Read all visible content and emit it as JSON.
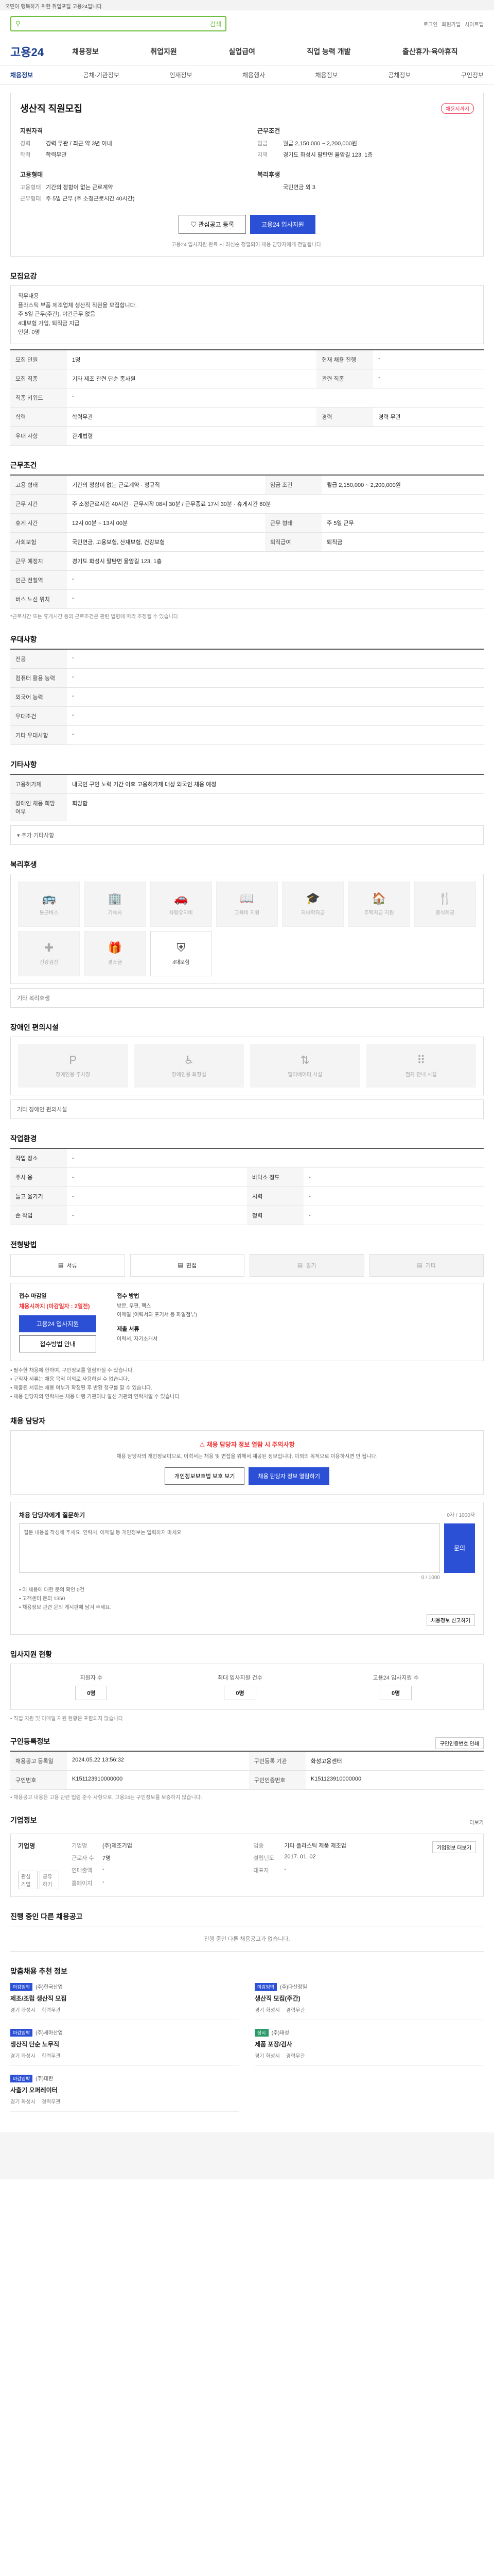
{
  "topbar": {
    "text": "국민이 행복하기 위한 취업포탈 고용24입니다."
  },
  "search": {
    "value": "",
    "button": "검색"
  },
  "user_links": [
    "로그인",
    "회원가입",
    "사이트맵"
  ],
  "logo": "고용24",
  "gnb": [
    "채용정보",
    "취업지원",
    "실업급여",
    "직업 능력 개발",
    "출산휴가·육아휴직"
  ],
  "subnav": [
    "채용정보",
    "공채·기관정보",
    "인재정보",
    "채용행사",
    "채용정보",
    "공채정보",
    "구인정보"
  ],
  "title": {
    "heading": "생산직 직원모집",
    "badge": "채용시까지",
    "left_title": "지원자격",
    "left_rows": [
      {
        "k": "경력",
        "v": "경력 무관 / 최근 약 3년 이내"
      },
      {
        "k": "학력",
        "v": "학력무관"
      }
    ],
    "right_title": "근무조건",
    "right_rows": [
      {
        "k": "임금",
        "v": "월급 2,150,000 ~ 2,200,000원"
      },
      {
        "k": "지역",
        "v": "경기도 화성시 팔탄면 율암길 123, 1층"
      }
    ],
    "left2_title": "고용형태",
    "left2_rows": [
      {
        "k": "고용형태",
        "v": "기간의 정함이 없는 근로계약"
      },
      {
        "k": "근무형태",
        "v": "주 5일 근무 (주 소정근로시간 40시간)"
      }
    ],
    "right2_title": "복리후생",
    "right2_rows": [
      {
        "k": "",
        "v": "국민연금 외 3"
      }
    ],
    "btn_interest": "관심공고 등록",
    "btn_apply": "고용24 입사지원",
    "note": "고용24 입사지원 완료 시 최신순 정렬되어 채용 담당자에게 전달됩니다."
  },
  "recruit": {
    "heading": "모집요강",
    "notice_lines": [
      "직무내용",
      "플라스틱 부품 제조업체 생산직 직원을 모집합니다.",
      "주 5일 근무(주간), 야간근무 없음",
      "4대보험 가입, 퇴직금 지급",
      "인원: 0명"
    ],
    "rows": [
      {
        "k": "모집 인원",
        "v": "1명",
        "k2": "현재 채용 진행",
        "v2": "-"
      },
      {
        "k": "모집 직종",
        "v": "기타 제조 관련 단순 종사원",
        "k2": "관련 직종",
        "v2": "-"
      },
      {
        "k": "직종 키워드",
        "v": "-",
        "k2": "",
        "v2": ""
      },
      {
        "k": "학력",
        "v": "학력무관",
        "k2": "경력",
        "v2": "경력 무관"
      },
      {
        "k": "우대 사항",
        "v": "관계법령",
        "k2": "",
        "v2": ""
      }
    ]
  },
  "conditions": {
    "heading": "근무조건",
    "rows": [
      {
        "k": "고용 형태",
        "v": "기간의 정함이 없는 근로계약 · 정규직",
        "k2": "임금 조건",
        "v2": "월급 2,150,000 ~ 2,200,000원"
      },
      {
        "k": "근무 시간",
        "v": "주 소정근로시간 40시간 · 근무시작 08시 30분 / 근무종료 17시 30분 · 휴게시간 60분",
        "k2": "",
        "v2": ""
      },
      {
        "k": "휴게 시간",
        "v": "12시 00분 ~ 13시 00분",
        "k2": "근무 형태",
        "v2": "주 5일 근무"
      },
      {
        "k": "사회보험",
        "v": "국민연금, 고용보험, 산재보험, 건강보험",
        "k2": "퇴직급여",
        "v2": "퇴직금"
      },
      {
        "k": "근무 예정지",
        "v": "경기도 화성시 팔탄면 율암길 123, 1층",
        "k2": "",
        "v2": ""
      },
      {
        "k": "인근 전철역",
        "v": "-",
        "k2": "",
        "v2": ""
      },
      {
        "k": "버스 노선 위치",
        "v": "-",
        "k2": "",
        "v2": ""
      }
    ],
    "footnote": "*근로시간 또는 휴게시간 등의 근로조건은 관련 법령에 따라 조정될 수 있습니다."
  },
  "preference": {
    "heading": "우대사항",
    "rows": [
      {
        "k": "전공",
        "v": "-"
      },
      {
        "k": "컴퓨터 활용 능력",
        "v": "-"
      },
      {
        "k": "외국어 능력",
        "v": "-"
      },
      {
        "k": "우대조건",
        "v": "-"
      },
      {
        "k": "기타 우대사항",
        "v": "-"
      }
    ]
  },
  "etc": {
    "heading": "기타사항",
    "rows": [
      {
        "k": "고용허가제",
        "v": "내국인 구인 노력 기간 이후 고용허가제 대상 외국인 채용 예정"
      },
      {
        "k": "장애인 채용 희망 여부",
        "v": "희망함"
      }
    ],
    "more": "추가 기타사항"
  },
  "welfare": {
    "heading": "복리후생",
    "items": [
      {
        "label": "통근버스",
        "icon": "bus-icon",
        "active": false
      },
      {
        "label": "기숙사",
        "icon": "building-icon",
        "active": false
      },
      {
        "label": "차량유지비",
        "icon": "car-icon",
        "active": false
      },
      {
        "label": "교육비 지원",
        "icon": "book-icon",
        "active": false
      },
      {
        "label": "자녀학자금",
        "icon": "school-icon",
        "active": false
      },
      {
        "label": "주택자금 지원",
        "icon": "house-icon",
        "active": false
      },
      {
        "label": "중식제공",
        "icon": "meal-icon",
        "active": false
      },
      {
        "label": "건강검진",
        "icon": "health-icon",
        "active": false
      },
      {
        "label": "경조금",
        "icon": "gift-icon",
        "active": false
      },
      {
        "label": "4대보험",
        "icon": "shield-icon",
        "active": true
      }
    ],
    "more": "기타 복리후생"
  },
  "facility": {
    "heading": "장애인 편의시설",
    "items": [
      {
        "label": "장애인용 주차장",
        "icon": "parking-icon"
      },
      {
        "label": "장애인용 화장실",
        "icon": "toilet-icon"
      },
      {
        "label": "엘리베이터 시설",
        "icon": "elevator-icon"
      },
      {
        "label": "점자 안내 시설",
        "icon": "braille-icon"
      }
    ],
    "more": "기타 장애인 편의시설"
  },
  "environment": {
    "heading": "작업환경",
    "rows": [
      {
        "k": "작업 장소",
        "v": "-",
        "k2": "",
        "v2": ""
      },
      {
        "k": "주사 용",
        "v": "-",
        "k2": "바닥소 정도",
        "v2": "-"
      },
      {
        "k": "들고 옮기기",
        "v": "-",
        "k2": "시력",
        "v2": "-"
      },
      {
        "k": "손 작업",
        "v": "-",
        "k2": "청력",
        "v2": "-"
      }
    ]
  },
  "method": {
    "heading": "전형방법",
    "boxes": [
      {
        "label": "서류",
        "off": false
      },
      {
        "label": "면접",
        "off": false
      },
      {
        "label": "필기",
        "off": true
      },
      {
        "label": "기타",
        "off": true
      }
    ]
  },
  "apply": {
    "col1_title": "접수 마감일",
    "col1_red": "채용시까지 (마감일자 : 2일전)",
    "col1_btn": "고용24 입사지원",
    "col1_btn2": "접수방법 안내",
    "col2_title": "접수 방법",
    "col2_lines": [
      "방문, 우편, 팩스",
      "이메일 (이력서와 포기서 등 파일첨부)"
    ],
    "col3_title": "제출 서류",
    "col3_lines": [
      "이력서, 자기소개서"
    ],
    "bullets": [
      "• 필수한 채용에 한하여, 구인정보를 열람하실 수 있습니다.",
      "• 구직자 서류는 채용 목적 이외로 사용하실 수 없습니다.",
      "• 제출된 서류는 채용 여부가 확정된 후 반환 청구를 할 수 있습니다.",
      "• 채용 담당자의 연락처는 채용 대행 기관이나 알선 기관의 연락처일 수 있습니다."
    ]
  },
  "contact": {
    "heading": "채용 담당자",
    "warn": "채용 담당자 정보 열람 시 주의사항",
    "desc": "채용 담당자의 개인정보이므로, 이력서는 채용 및 면접을 위해서 제공된 정보입니다. 이외의 목적으로 이용하시면 안 됩니다.",
    "btn1": "개인정보보호법 보호 보기",
    "btn2": "채용 담당자 정보 열람하기",
    "inquiry_title": "채용 담당자에게 질문하기",
    "inquiry_hint": "0자 / 1000자",
    "inquiry_placeholder": "질문 내용을 작성해 주세요. 연락처, 이메일 등 개인정보는 입력하지 마세요.",
    "inquiry_submit": "문의",
    "counter": "0 / 1000",
    "notes": [
      "• 이 채용에 대한 문의 확인 0건",
      "• 고객센터 문의 1350",
      "• 채용정보 관련 문의 게시판에 남겨 주세요."
    ],
    "report_btn": "채용정보 신고하기"
  },
  "status": {
    "heading": "입사지원 현황",
    "items": [
      {
        "label": "지원자 수",
        "value": "0명"
      },
      {
        "label": "최대 입사지원 건수",
        "value": "0명"
      },
      {
        "label": "고용24 입사지원 수",
        "value": "0명"
      }
    ],
    "note": "• 직접 지원 및 이메일 지원 현황은 포함되지 않습니다."
  },
  "regist": {
    "heading": "구인등록정보",
    "btn": "구인인증번호 인쇄",
    "rows": [
      {
        "k": "채용공고 등록일",
        "v": "2024.05.22 13:56:32",
        "k2": "구인등록 기관",
        "v2": "화성고용센터"
      },
      {
        "k": "구인번호",
        "v": "K151123910000000",
        "k2": "구인인증번호",
        "v2": "K151123910000000"
      }
    ],
    "note": "• 채용공고 내용은 고용 관련 법령 준수 사항으로, 고용24는 구인정보를 보증하지 않습니다."
  },
  "company": {
    "heading": "기업정보",
    "more": "더보기",
    "name": "기업명",
    "follow": [
      "관심기업",
      "공유하기"
    ],
    "rows": [
      {
        "k": "기업명",
        "v": "(주)제조기업"
      },
      {
        "k": "업종",
        "v": "기타 플라스틱 제품 제조업"
      },
      {
        "k": "근로자 수",
        "v": "7명"
      },
      {
        "k": "설립년도",
        "v": "2017. 01. 02"
      },
      {
        "k": "연매출액",
        "v": "-"
      },
      {
        "k": "대표자",
        "v": "-"
      },
      {
        "k": "홈페이지",
        "v": "-"
      }
    ],
    "btn": "기업정보 더보기"
  },
  "other": {
    "heading": "진행 중인 다른 채용공고",
    "empty": "진행 중인 다른 채용공고가 없습니다."
  },
  "recommend": {
    "heading": "맞춤채용 추천 정보",
    "cards": [
      {
        "tag": "마감임박",
        "company": "(주)한국산업",
        "job": "제조/조립 생산직 모집",
        "loc1": "경기 화성시",
        "loc2": "학력무관",
        "green": false
      },
      {
        "tag": "마감임박",
        "company": "(주)다산정밀",
        "job": "생산직 모집(주간)",
        "loc1": "경기 화성시",
        "loc2": "경력무관",
        "green": false
      },
      {
        "tag": "마감임박",
        "company": "(주)세아산업",
        "job": "생산직 단순 노무직",
        "loc1": "경기 화성시",
        "loc2": "학력무관",
        "green": false
      },
      {
        "tag": "상시",
        "company": "(주)태성",
        "job": "제품 포장/검사",
        "loc1": "경기 화성시",
        "loc2": "경력무관",
        "green": true
      },
      {
        "tag": "마감임박",
        "company": "(주)대한",
        "job": "사출기 오퍼레이터",
        "loc1": "경기 화성시",
        "loc2": "경력무관",
        "green": false
      }
    ]
  },
  "colors": {
    "accent": "#2b50d6",
    "brand": "#1b3f8f",
    "search": "#6bbf3b",
    "warn": "#e33"
  }
}
